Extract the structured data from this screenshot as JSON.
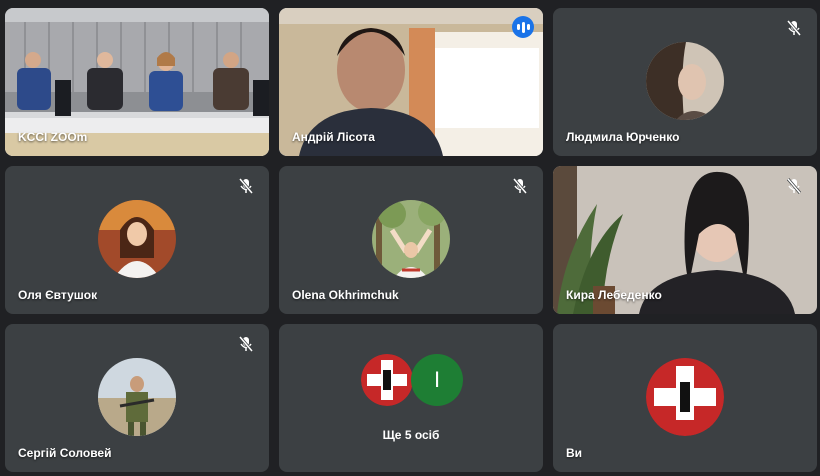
{
  "participants": [
    {
      "name": "KCCI ZOOm"
    },
    {
      "name": "Андрій Лісота"
    },
    {
      "name": "Людмила Юрченко"
    },
    {
      "name": "Оля Євтушок"
    },
    {
      "name": "Olena Okhrimchuk"
    },
    {
      "name": "Кира Лебеденко"
    },
    {
      "name": "Сергій Соловей"
    },
    {
      "more_label": "Ще 5 осіб",
      "avatar_letter": "I"
    },
    {
      "name": "Ви"
    }
  ],
  "icons": {
    "muted": "mic-off-icon",
    "speaking": "audio-wave-icon"
  },
  "colors": {
    "background": "#202124",
    "tile": "#3c4043",
    "active_border": "#8ab4f8",
    "speaking_badge": "#1a73e8",
    "letter_avatar": "#1e7e34"
  }
}
